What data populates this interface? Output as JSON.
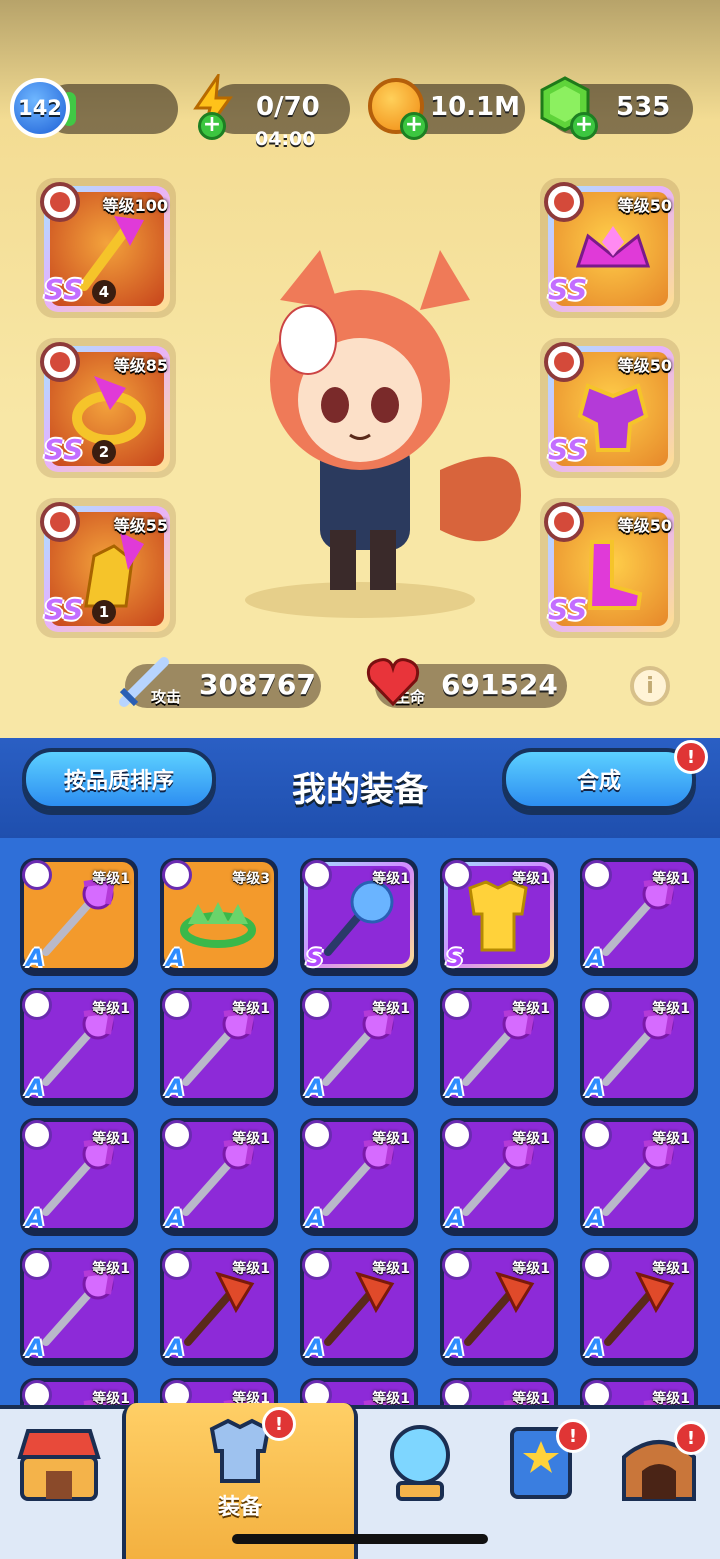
{
  "hud": {
    "player_level": "142",
    "energy": "0/70",
    "energy_timer": "04:00",
    "coins": "10.1M",
    "gems": "535"
  },
  "equipped": [
    {
      "slot": "weapon",
      "level": "等级100",
      "grade": "SS",
      "count": "4"
    },
    {
      "slot": "ring",
      "level": "等级85",
      "grade": "SS",
      "count": "2"
    },
    {
      "slot": "gloves",
      "level": "等级55",
      "grade": "SS",
      "count": "1"
    },
    {
      "slot": "helmet",
      "level": "等级50",
      "grade": "SS",
      "count": ""
    },
    {
      "slot": "armor",
      "level": "等级50",
      "grade": "SS",
      "count": ""
    },
    {
      "slot": "boots",
      "level": "等级50",
      "grade": "SS",
      "count": ""
    }
  ],
  "stats": {
    "attack_label": "攻击",
    "attack": "308767",
    "hp_label": "生命",
    "hp": "691524"
  },
  "panel": {
    "sort_button": "按品质排序",
    "title": "我的装备",
    "merge_button": "合成",
    "merge_badge": "!"
  },
  "inventory": [
    {
      "level": "等级1",
      "grade": "A",
      "style": "orange",
      "icon": "staff"
    },
    {
      "level": "等级3",
      "grade": "A",
      "style": "orange",
      "icon": "green-crown"
    },
    {
      "level": "等级1",
      "grade": "S",
      "style": "s",
      "icon": "blue-staff"
    },
    {
      "level": "等级1",
      "grade": "S",
      "style": "s",
      "icon": "gold-armor"
    },
    {
      "level": "等级1",
      "grade": "A",
      "style": "purple",
      "icon": "staff"
    },
    {
      "level": "等级1",
      "grade": "A",
      "style": "purple",
      "icon": "staff"
    },
    {
      "level": "等级1",
      "grade": "A",
      "style": "purple",
      "icon": "staff"
    },
    {
      "level": "等级1",
      "grade": "A",
      "style": "purple",
      "icon": "staff"
    },
    {
      "level": "等级1",
      "grade": "A",
      "style": "purple",
      "icon": "staff"
    },
    {
      "level": "等级1",
      "grade": "A",
      "style": "purple",
      "icon": "staff"
    },
    {
      "level": "等级1",
      "grade": "A",
      "style": "purple",
      "icon": "staff"
    },
    {
      "level": "等级1",
      "grade": "A",
      "style": "purple",
      "icon": "staff"
    },
    {
      "level": "等级1",
      "grade": "A",
      "style": "purple",
      "icon": "staff"
    },
    {
      "level": "等级1",
      "grade": "A",
      "style": "purple",
      "icon": "staff"
    },
    {
      "level": "等级1",
      "grade": "A",
      "style": "purple",
      "icon": "staff"
    },
    {
      "level": "等级1",
      "grade": "A",
      "style": "purple",
      "icon": "staff"
    },
    {
      "level": "等级1",
      "grade": "A",
      "style": "purple",
      "icon": "red-axe"
    },
    {
      "level": "等级1",
      "grade": "A",
      "style": "purple",
      "icon": "red-axe"
    },
    {
      "level": "等级1",
      "grade": "A",
      "style": "purple",
      "icon": "red-axe"
    },
    {
      "level": "等级1",
      "grade": "A",
      "style": "purple",
      "icon": "red-axe"
    },
    {
      "level": "等级1",
      "grade": "",
      "style": "purple",
      "icon": "staff"
    },
    {
      "level": "等级1",
      "grade": "",
      "style": "purple",
      "icon": "staff"
    },
    {
      "level": "等级1",
      "grade": "",
      "style": "purple",
      "icon": "staff"
    },
    {
      "level": "等级1",
      "grade": "",
      "style": "purple",
      "icon": "staff"
    },
    {
      "level": "等级1",
      "grade": "",
      "style": "purple",
      "icon": "staff"
    }
  ],
  "nav": {
    "equipment_label": "装备",
    "badge": "!"
  }
}
